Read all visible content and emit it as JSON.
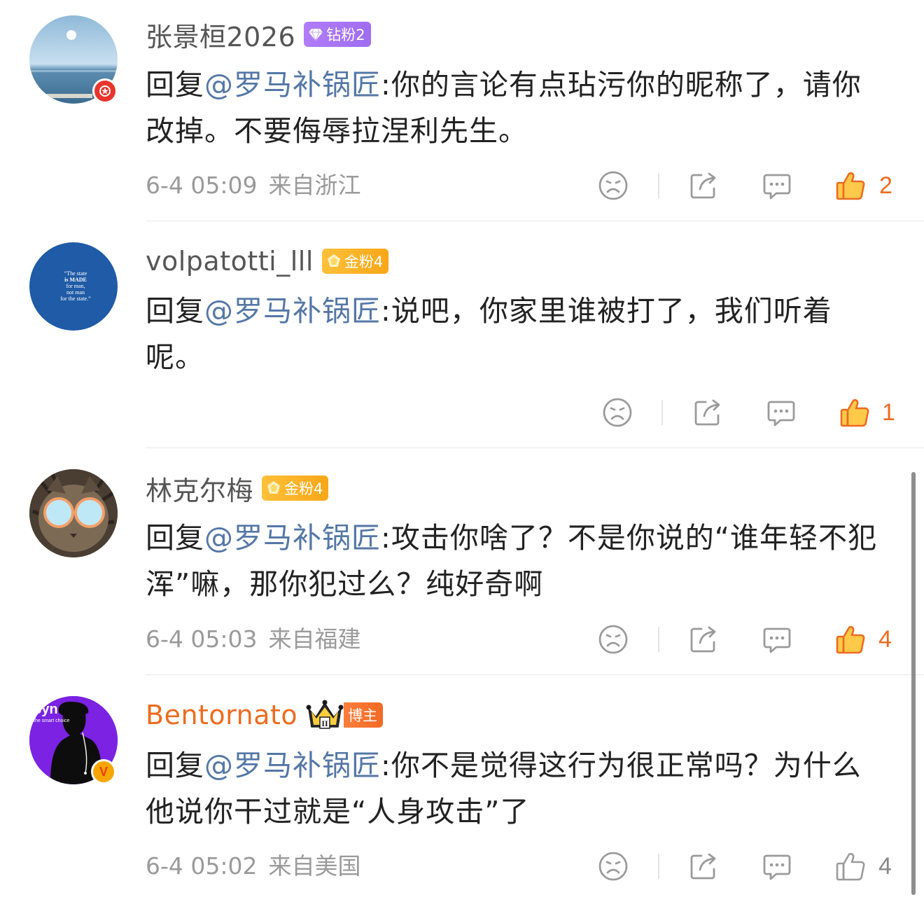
{
  "comments": [
    {
      "username": "张景桓2026",
      "badge": "钻粉2",
      "text_prefix": "回复",
      "mention": "@罗马补锅匠",
      "text": ":你的言论有点玷污你的昵称了，请你改掉。不要侮辱拉涅利先生。",
      "time": "6-4 05:09",
      "location": "来自浙江",
      "likes": "2",
      "avatar_badge": "red-star-badge"
    },
    {
      "username": "volpatotti_lll",
      "badge": "金粉4",
      "text_prefix": "回复",
      "mention": "@罗马补锅匠",
      "text": ":说吧，你家里谁被打了，我们听着呢。",
      "likes": "1",
      "avatar_text": [
        "“The state",
        "is MADE",
        "for man,",
        "not man",
        "for the state.”"
      ]
    },
    {
      "username": "林克尔梅",
      "badge": "金粉4",
      "text_prefix": "回复",
      "mention": "@罗马补锅匠",
      "text": ":攻击你啥了？不是你说的“谁年轻不犯浑”嘛，那你犯过么？纯好奇啊",
      "time": "6-4 05:03",
      "location": "来自福建",
      "likes": "4"
    },
    {
      "username": "Bentornato",
      "badge": "博主",
      "text_prefix": "回复",
      "mention": "@罗马补锅匠",
      "text": ":你不是觉得这行为很正常吗？为什么他说你干过就是“人身攻击”了",
      "time": "6-4 05:02",
      "location": "来自美国",
      "likes": "4",
      "avatar_text": "Syn",
      "avatar_subtext": "the smart choice",
      "avatar_badge_label": "V",
      "crown_label": "II"
    }
  ],
  "colors": {
    "accent": "#ec6c20",
    "mention": "#5477a6",
    "meta": "#9a9a9a"
  },
  "icons": [
    "dislike-face-icon",
    "share-icon",
    "comment-icon",
    "like-thumb-icon"
  ]
}
